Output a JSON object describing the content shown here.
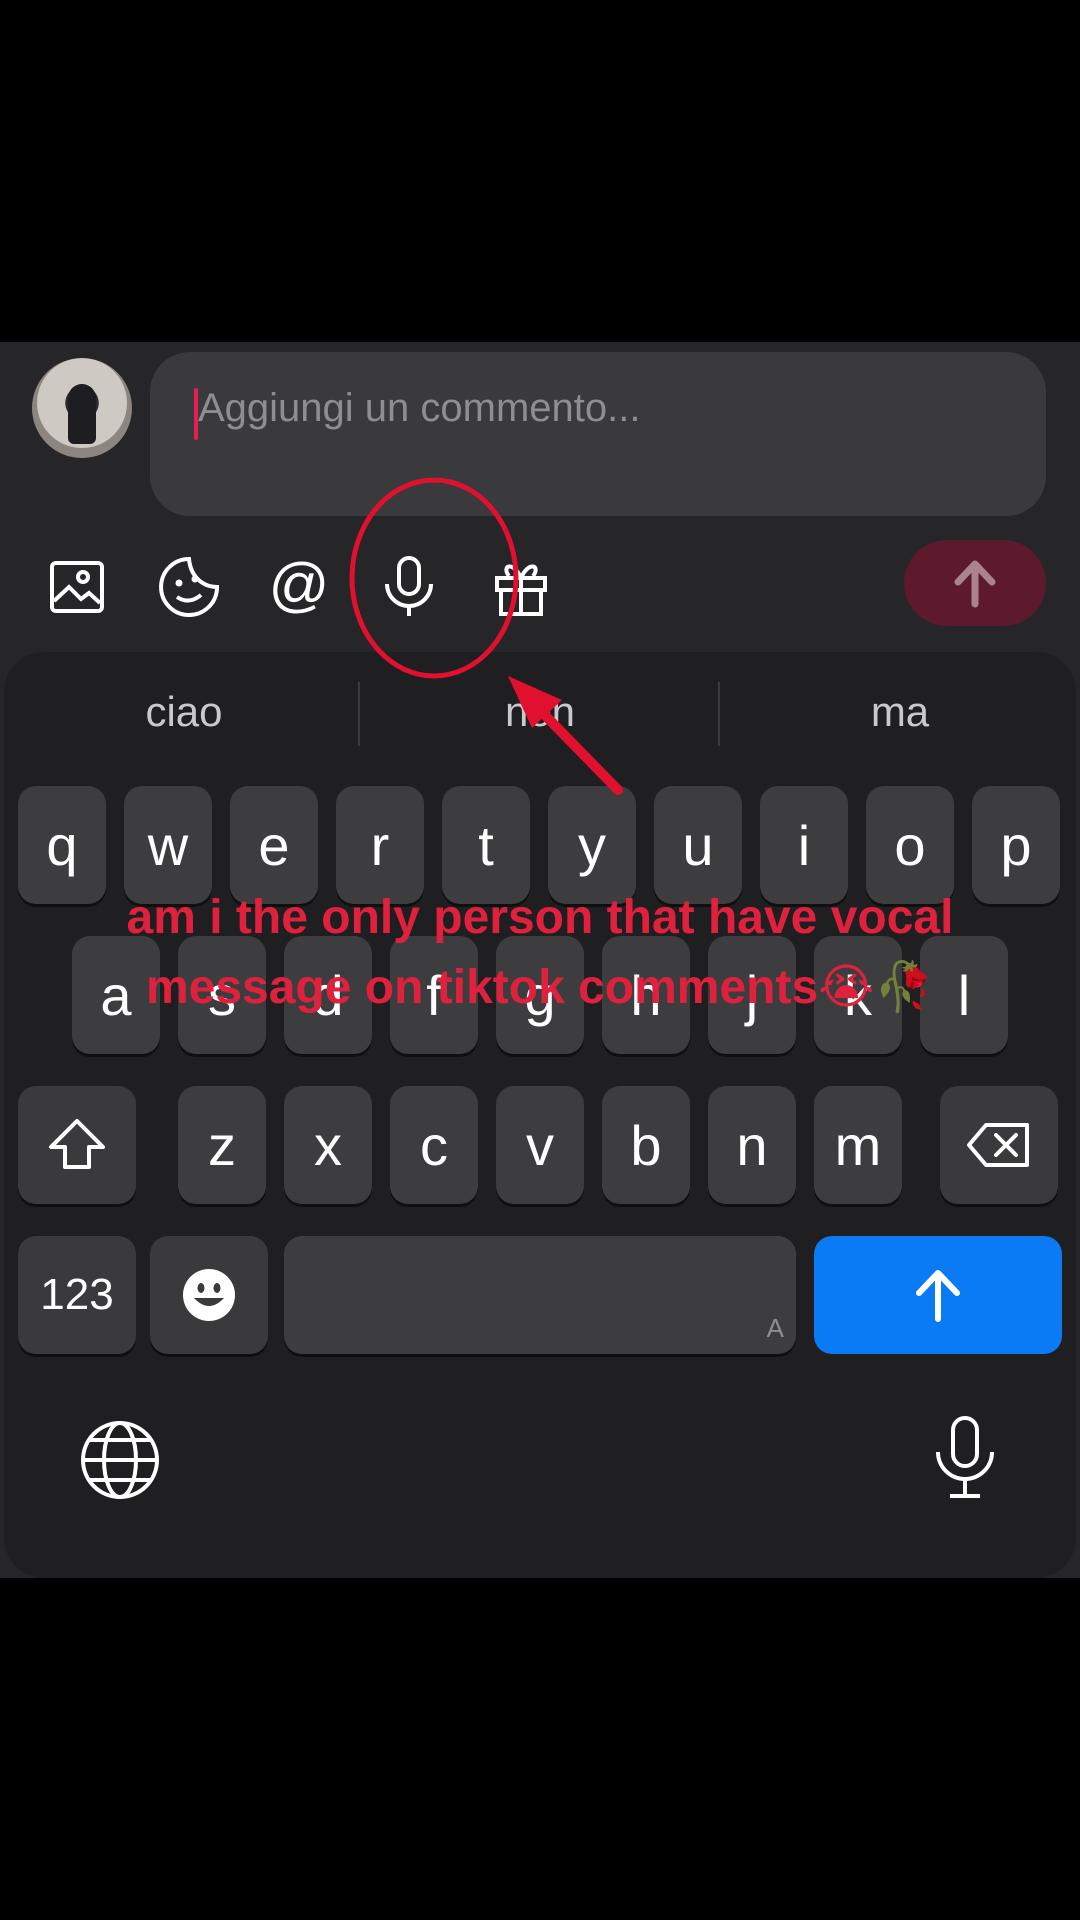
{
  "composer": {
    "placeholder": "Aggiungi un commento...",
    "toolbar": [
      "image-icon",
      "sticker-icon",
      "mention-icon",
      "microphone-icon",
      "gift-icon"
    ],
    "send_color": "#5c1a2c"
  },
  "keyboard": {
    "suggestions": [
      "ciao",
      "non",
      "ma"
    ],
    "row1": [
      "q",
      "w",
      "e",
      "r",
      "t",
      "y",
      "u",
      "i",
      "o",
      "p"
    ],
    "row2": [
      "a",
      "s",
      "d",
      "f",
      "g",
      "h",
      "j",
      "k",
      "l"
    ],
    "row3": [
      "z",
      "x",
      "c",
      "v",
      "b",
      "n",
      "m"
    ],
    "numbers_label": "123",
    "space_hint": "A",
    "return_color": "#0a7af5"
  },
  "overlay": {
    "line1": "am i the only person that have vocal",
    "line2": "message on tiktok comments😭🥀",
    "color": "#e0213d"
  }
}
